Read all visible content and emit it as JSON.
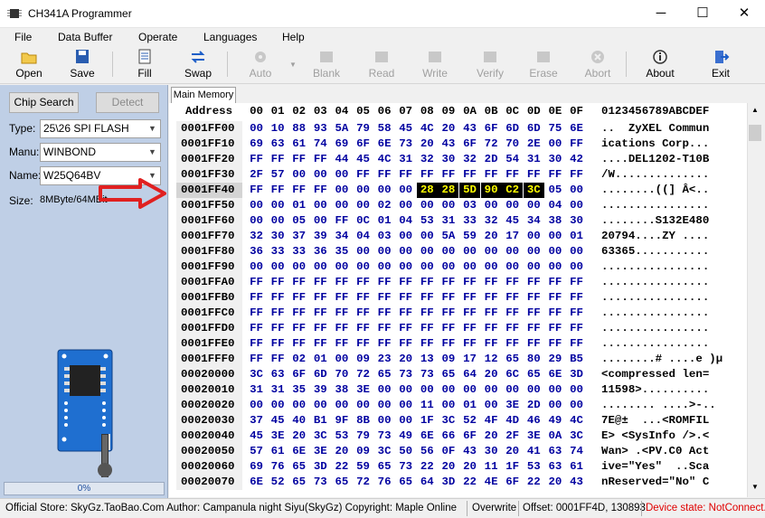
{
  "window": {
    "title": "CH341A Programmer",
    "minimize": "─",
    "maximize": "☐",
    "close": "✕"
  },
  "menu": [
    "File",
    "Data Buffer",
    "Operate",
    "Languages",
    "Help"
  ],
  "toolbar": [
    {
      "label": "Open",
      "icon": "open-folder-icon",
      "enabled": true
    },
    {
      "label": "Save",
      "icon": "save-disk-icon",
      "enabled": true
    },
    {
      "label": "Fill",
      "icon": "fill-icon",
      "enabled": true
    },
    {
      "label": "Swap",
      "icon": "swap-arrows-icon",
      "enabled": true
    },
    {
      "label": "Auto",
      "icon": "auto-gear-icon",
      "enabled": false
    },
    {
      "label": "Blank",
      "icon": "blank-icon",
      "enabled": false
    },
    {
      "label": "Read",
      "icon": "read-icon",
      "enabled": false
    },
    {
      "label": "Write",
      "icon": "write-icon",
      "enabled": false
    },
    {
      "label": "Verify",
      "icon": "verify-icon",
      "enabled": false
    },
    {
      "label": "Erase",
      "icon": "erase-icon",
      "enabled": false
    },
    {
      "label": "Abort",
      "icon": "abort-icon",
      "enabled": false
    },
    {
      "label": "About",
      "icon": "info-icon",
      "enabled": true
    },
    {
      "label": "Exit",
      "icon": "exit-icon",
      "enabled": true
    }
  ],
  "left": {
    "chip_search": "Chip Search",
    "detect": "Detect",
    "type_label": "Type:",
    "type_value": "25\\26 SPI FLASH",
    "manu_label": "Manu:",
    "manu_value": "WINBOND",
    "name_label": "Name:",
    "name_value": "W25Q64BV",
    "size_label": "Size:",
    "size_value": "8MByte/64MBit",
    "progress": 0,
    "progress_text": "0%"
  },
  "tab": "Main Memory",
  "hex": {
    "header_addr": "Address",
    "header_cols": [
      "00",
      "01",
      "02",
      "03",
      "04",
      "05",
      "06",
      "07",
      "08",
      "09",
      "0A",
      "0B",
      "0C",
      "0D",
      "0E",
      "0F"
    ],
    "header_ascii": "0123456789ABCDEF",
    "selected_row": 4,
    "selected_cols": [
      8,
      9,
      10,
      11,
      12,
      13
    ],
    "rows": [
      {
        "addr": "0001FF00",
        "bytes": [
          "00",
          "10",
          "88",
          "93",
          "5A",
          "79",
          "58",
          "45",
          "4C",
          "20",
          "43",
          "6F",
          "6D",
          "6D",
          "75",
          "6E"
        ],
        "ascii": "..  ZyXEL Commun"
      },
      {
        "addr": "0001FF10",
        "bytes": [
          "69",
          "63",
          "61",
          "74",
          "69",
          "6F",
          "6E",
          "73",
          "20",
          "43",
          "6F",
          "72",
          "70",
          "2E",
          "00",
          "FF"
        ],
        "ascii": "ications Corp..."
      },
      {
        "addr": "0001FF20",
        "bytes": [
          "FF",
          "FF",
          "FF",
          "FF",
          "44",
          "45",
          "4C",
          "31",
          "32",
          "30",
          "32",
          "2D",
          "54",
          "31",
          "30",
          "42"
        ],
        "ascii": "....DEL1202-T10B"
      },
      {
        "addr": "0001FF30",
        "bytes": [
          "2F",
          "57",
          "00",
          "00",
          "00",
          "FF",
          "FF",
          "FF",
          "FF",
          "FF",
          "FF",
          "FF",
          "FF",
          "FF",
          "FF",
          "FF"
        ],
        "ascii": "/W.............."
      },
      {
        "addr": "0001FF40",
        "bytes": [
          "FF",
          "FF",
          "FF",
          "FF",
          "00",
          "00",
          "00",
          "00",
          "28",
          "28",
          "5D",
          "90",
          "C2",
          "3C",
          "05",
          "00"
        ],
        "ascii": "........((] Â<.."
      },
      {
        "addr": "0001FF50",
        "bytes": [
          "00",
          "00",
          "01",
          "00",
          "00",
          "00",
          "02",
          "00",
          "00",
          "00",
          "03",
          "00",
          "00",
          "00",
          "04",
          "00"
        ],
        "ascii": "................"
      },
      {
        "addr": "0001FF60",
        "bytes": [
          "00",
          "00",
          "05",
          "00",
          "FF",
          "0C",
          "01",
          "04",
          "53",
          "31",
          "33",
          "32",
          "45",
          "34",
          "38",
          "30"
        ],
        "ascii": "........S132E480"
      },
      {
        "addr": "0001FF70",
        "bytes": [
          "32",
          "30",
          "37",
          "39",
          "34",
          "04",
          "03",
          "00",
          "00",
          "5A",
          "59",
          "20",
          "17",
          "00",
          "00",
          "01"
        ],
        "ascii": "20794....ZY ...."
      },
      {
        "addr": "0001FF80",
        "bytes": [
          "36",
          "33",
          "33",
          "36",
          "35",
          "00",
          "00",
          "00",
          "00",
          "00",
          "00",
          "00",
          "00",
          "00",
          "00",
          "00"
        ],
        "ascii": "63365..........."
      },
      {
        "addr": "0001FF90",
        "bytes": [
          "00",
          "00",
          "00",
          "00",
          "00",
          "00",
          "00",
          "00",
          "00",
          "00",
          "00",
          "00",
          "00",
          "00",
          "00",
          "00"
        ],
        "ascii": "................"
      },
      {
        "addr": "0001FFA0",
        "bytes": [
          "FF",
          "FF",
          "FF",
          "FF",
          "FF",
          "FF",
          "FF",
          "FF",
          "FF",
          "FF",
          "FF",
          "FF",
          "FF",
          "FF",
          "FF",
          "FF"
        ],
        "ascii": "................"
      },
      {
        "addr": "0001FFB0",
        "bytes": [
          "FF",
          "FF",
          "FF",
          "FF",
          "FF",
          "FF",
          "FF",
          "FF",
          "FF",
          "FF",
          "FF",
          "FF",
          "FF",
          "FF",
          "FF",
          "FF"
        ],
        "ascii": "................"
      },
      {
        "addr": "0001FFC0",
        "bytes": [
          "FF",
          "FF",
          "FF",
          "FF",
          "FF",
          "FF",
          "FF",
          "FF",
          "FF",
          "FF",
          "FF",
          "FF",
          "FF",
          "FF",
          "FF",
          "FF"
        ],
        "ascii": "................"
      },
      {
        "addr": "0001FFD0",
        "bytes": [
          "FF",
          "FF",
          "FF",
          "FF",
          "FF",
          "FF",
          "FF",
          "FF",
          "FF",
          "FF",
          "FF",
          "FF",
          "FF",
          "FF",
          "FF",
          "FF"
        ],
        "ascii": "................"
      },
      {
        "addr": "0001FFE0",
        "bytes": [
          "FF",
          "FF",
          "FF",
          "FF",
          "FF",
          "FF",
          "FF",
          "FF",
          "FF",
          "FF",
          "FF",
          "FF",
          "FF",
          "FF",
          "FF",
          "FF"
        ],
        "ascii": "................"
      },
      {
        "addr": "0001FFF0",
        "bytes": [
          "FF",
          "FF",
          "02",
          "01",
          "00",
          "09",
          "23",
          "20",
          "13",
          "09",
          "17",
          "12",
          "65",
          "80",
          "29",
          "B5"
        ],
        "ascii": "........# ....e )µ"
      },
      {
        "addr": "00020000",
        "bytes": [
          "3C",
          "63",
          "6F",
          "6D",
          "70",
          "72",
          "65",
          "73",
          "73",
          "65",
          "64",
          "20",
          "6C",
          "65",
          "6E",
          "3D"
        ],
        "ascii": "<compressed len="
      },
      {
        "addr": "00020010",
        "bytes": [
          "31",
          "31",
          "35",
          "39",
          "38",
          "3E",
          "00",
          "00",
          "00",
          "00",
          "00",
          "00",
          "00",
          "00",
          "00",
          "00"
        ],
        "ascii": "11598>.........."
      },
      {
        "addr": "00020020",
        "bytes": [
          "00",
          "00",
          "00",
          "00",
          "00",
          "00",
          "00",
          "00",
          "11",
          "00",
          "01",
          "00",
          "3E",
          "2D",
          "00",
          "00"
        ],
        "ascii": "........ ....>-.."
      },
      {
        "addr": "00020030",
        "bytes": [
          "37",
          "45",
          "40",
          "B1",
          "9F",
          "8B",
          "00",
          "00",
          "1F",
          "3C",
          "52",
          "4F",
          "4D",
          "46",
          "49",
          "4C"
        ],
        "ascii": "7E@±  ...<ROMFIL"
      },
      {
        "addr": "00020040",
        "bytes": [
          "45",
          "3E",
          "20",
          "3C",
          "53",
          "79",
          "73",
          "49",
          "6E",
          "66",
          "6F",
          "20",
          "2F",
          "3E",
          "0A",
          "3C"
        ],
        "ascii": "E> <SysInfo />.<"
      },
      {
        "addr": "00020050",
        "bytes": [
          "57",
          "61",
          "6E",
          "3E",
          "20",
          "09",
          "3C",
          "50",
          "56",
          "0F",
          "43",
          "30",
          "20",
          "41",
          "63",
          "74"
        ],
        "ascii": "Wan> .<PV.C0 Act"
      },
      {
        "addr": "00020060",
        "bytes": [
          "69",
          "76",
          "65",
          "3D",
          "22",
          "59",
          "65",
          "73",
          "22",
          "20",
          "20",
          "11",
          "1F",
          "53",
          "63",
          "61"
        ],
        "ascii": "ive=\"Yes\"  ..Sca"
      },
      {
        "addr": "00020070",
        "bytes": [
          "6E",
          "52",
          "65",
          "73",
          "65",
          "72",
          "76",
          "65",
          "64",
          "3D",
          "22",
          "4E",
          "6F",
          "22",
          "20",
          "43"
        ],
        "ascii": "nReserved=\"No\" C"
      }
    ]
  },
  "status": {
    "left": "Official Store: SkyGz.TaoBao.Com Author: Campanula night Siyu(SkyGz) Copyright: Maple Online",
    "mode": "Overwrite",
    "offset": "Offset: 0001FF4D, 130893",
    "device": "Device state: NotConnect.",
    "device_color": "#e00000"
  },
  "colors": {
    "hex_text": "#0000a0",
    "selection_bg": "#000000",
    "selection_fg": "#ffff00",
    "panel_bg": "#bfcfe6",
    "chip_blue": "#1f6fd0",
    "arrow_red": "#e02020"
  }
}
